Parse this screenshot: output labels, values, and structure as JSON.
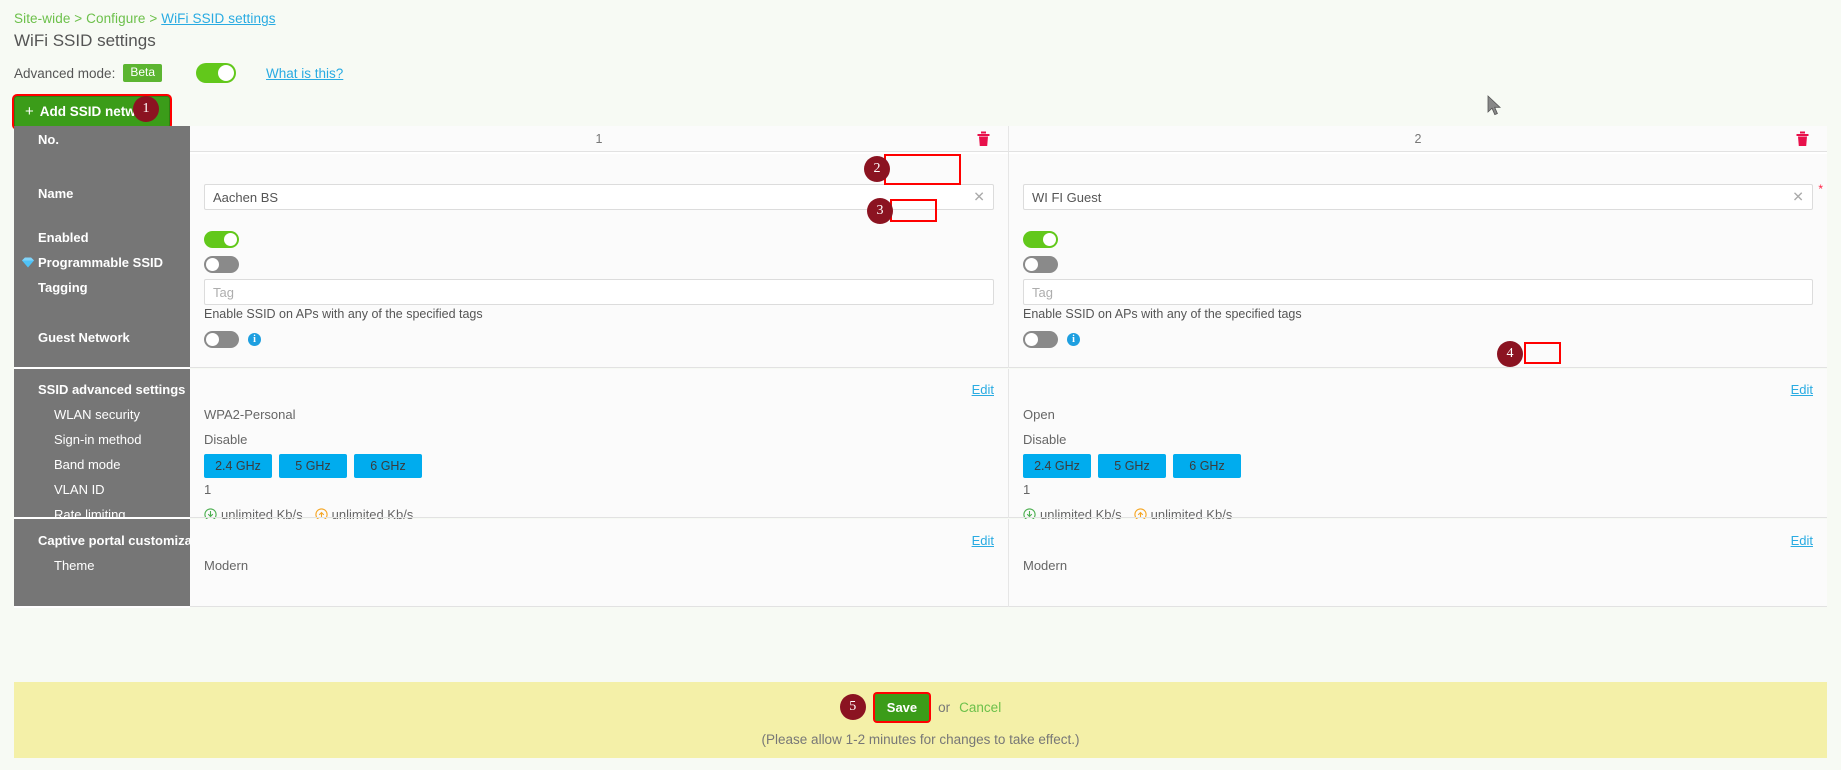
{
  "breadcrumb": {
    "prefix": "Site-wide > Configure > ",
    "current": "WiFi SSID settings"
  },
  "header": {
    "title": "WiFi SSID settings",
    "advanced_mode_label": "Advanced mode:",
    "beta_badge": "Beta",
    "advanced_mode_on": true,
    "what_is_this": "What is this?"
  },
  "toolbar": {
    "add_ssid_label": "Add SSID network",
    "add_ssid_plus": "+"
  },
  "annotations": [
    {
      "id": "1",
      "label": "1"
    },
    {
      "id": "2",
      "label": "2"
    },
    {
      "id": "3",
      "label": "3"
    },
    {
      "id": "4",
      "label": "4"
    },
    {
      "id": "5",
      "label": "5"
    }
  ],
  "table": {
    "row_labels": {
      "no": "No.",
      "name": "Name",
      "enabled": "Enabled",
      "programmable_ssid": "Programmable SSID",
      "tagging": "Tagging",
      "guest_network": "Guest Network",
      "ssid_advanced_settings": "SSID advanced settings",
      "wlan_security": "WLAN security",
      "signin_method": "Sign-in method",
      "band_mode": "Band mode",
      "vlan_id": "VLAN ID",
      "rate_limiting": "Rate limiting",
      "captive_portal_customization": "Captive portal customization",
      "theme": "Theme"
    },
    "tag_placeholder": "Tag",
    "tag_help": "Enable SSID on APs with any of the specified tags",
    "edit_label": "Edit",
    "columns": [
      {
        "no": "1",
        "name": "Aachen BS",
        "enabled": true,
        "programmable_ssid": false,
        "tag_value": "",
        "guest_network": false,
        "wlan_security": "WPA2-Personal",
        "signin_method": "Disable",
        "bands": [
          "2.4 GHz",
          "5 GHz",
          "6 GHz"
        ],
        "vlan_id": "1",
        "rate_down": "unlimited Kb/s",
        "rate_up": "unlimited Kb/s",
        "theme": "Modern"
      },
      {
        "no": "2",
        "name": "WI FI Guest",
        "enabled": true,
        "programmable_ssid": false,
        "tag_value": "",
        "guest_network": false,
        "wlan_security": "Open",
        "signin_method": "Disable",
        "bands": [
          "2.4 GHz",
          "5 GHz",
          "6 GHz"
        ],
        "vlan_id": "1",
        "rate_down": "unlimited Kb/s",
        "rate_up": "unlimited Kb/s",
        "theme": "Modern"
      }
    ]
  },
  "footer": {
    "save_label": "Save",
    "or_label": "or",
    "cancel_label": "Cancel",
    "note": "(Please allow 1-2 minutes for changes to take effect.)"
  },
  "colors": {
    "accent_green": "#6cc04a",
    "link_blue": "#29abe2",
    "band_blue": "#00acee",
    "save_green": "#3b9c19",
    "annotation_red": "#8b1321",
    "highlight_red": "#ff0000",
    "sidebar_grey": "#767676",
    "savebar_yellow": "#f4f0a8"
  }
}
